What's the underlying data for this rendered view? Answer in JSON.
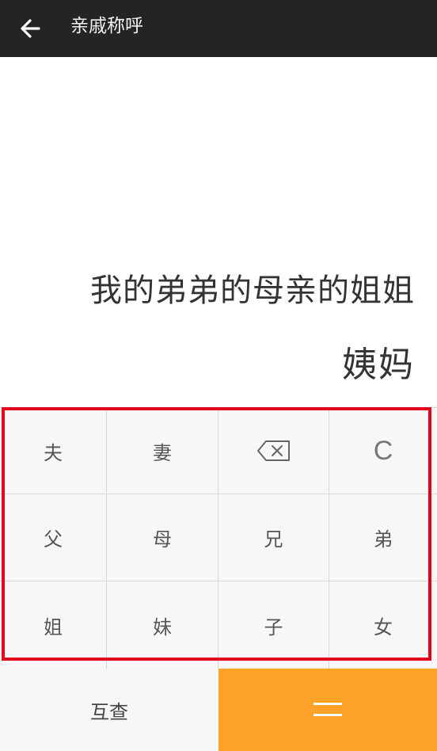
{
  "header": {
    "title": "亲戚称呼",
    "back_icon": "arrow-left-icon"
  },
  "display": {
    "expression": "我的弟弟的母亲的姐姐",
    "result": "姨妈"
  },
  "keypad": {
    "rows": [
      [
        {
          "label": "夫"
        },
        {
          "label": "妻"
        },
        {
          "label": "",
          "icon": "backspace-icon"
        },
        {
          "label": "C"
        }
      ],
      [
        {
          "label": "父"
        },
        {
          "label": "母"
        },
        {
          "label": "兄"
        },
        {
          "label": "弟"
        }
      ],
      [
        {
          "label": "姐"
        },
        {
          "label": "妹"
        },
        {
          "label": "子"
        },
        {
          "label": "女"
        }
      ]
    ]
  },
  "actions": {
    "check_label": "互查",
    "equals_icon": "equals-icon"
  },
  "colors": {
    "header_bg": "#242424",
    "accent": "#ffa228",
    "highlight_border": "#e5001c"
  }
}
